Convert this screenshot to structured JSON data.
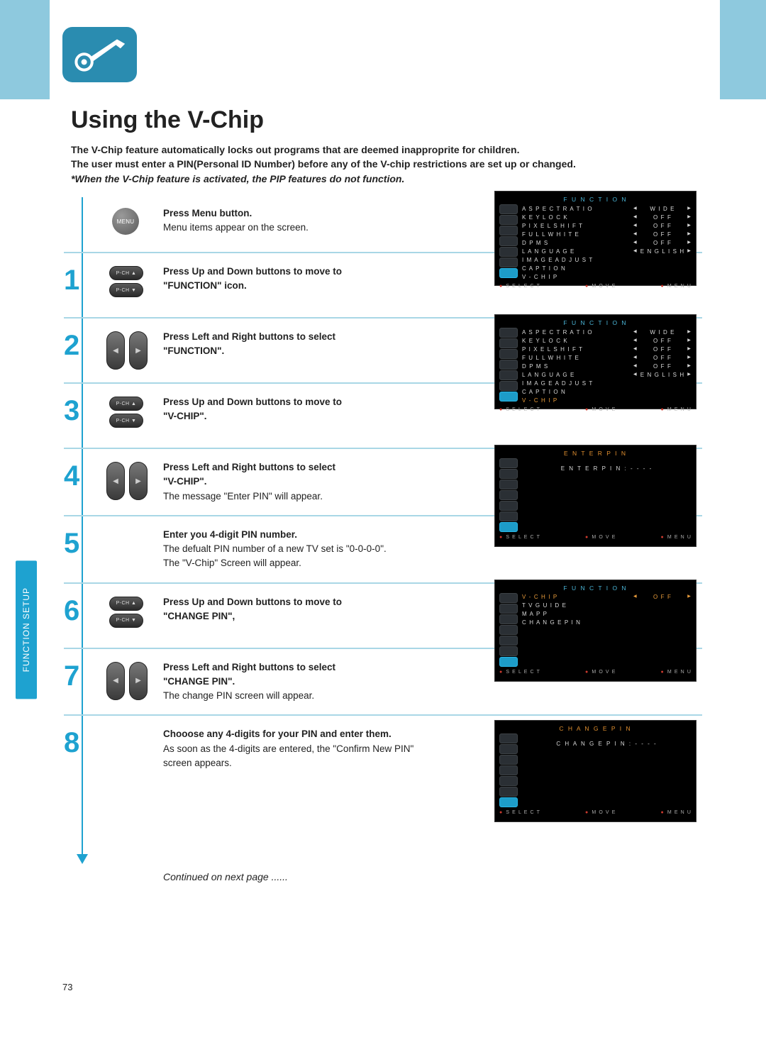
{
  "page_number": "73",
  "side_tab": "FUNCTION SETUP",
  "title": "Using the V-Chip",
  "intro": {
    "line1": "The V-Chip feature automatically locks out programs that are deemed inapproprite for children.",
    "line2": "The user must enter a PIN(Personal ID Number) before any of the V-chip restrictions are set up or changed.",
    "note": "*When the V-Chip feature is activated, the PIP features do not function."
  },
  "continued": "Continued on next page ......",
  "menu_label": "MENU",
  "pch_up": "P-CH ▲",
  "pch_down": "P-CH ▼",
  "arrow_left": "◀",
  "arrow_right": "▶",
  "steps": [
    {
      "num": "",
      "bold": "Press Menu button.",
      "plain": "Menu items appear on the screen."
    },
    {
      "num": "1",
      "bold1": "Press Up and Down buttons to move to",
      "bold2": "\"FUNCTION\" icon."
    },
    {
      "num": "2",
      "bold1": "Press Left and Right buttons to select",
      "bold2": "\"FUNCTION\"."
    },
    {
      "num": "3",
      "bold1": "Press Up and Down buttons to move to",
      "bold2": "\"V-CHIP\"."
    },
    {
      "num": "4",
      "bold1": "Press Left and Right buttons to select",
      "bold2": "\"V-CHIP\".",
      "plain": "The message \"Enter PIN\" will appear."
    },
    {
      "num": "5",
      "bold": "Enter you 4-digit PIN number.",
      "plain1": "The defualt PIN number of a new TV set is \"0-0-0-0\".",
      "plain2": "The \"V-Chip\" Screen will appear."
    },
    {
      "num": "6",
      "bold1": "Press Up and Down buttons to move  to",
      "bold2": "\"CHANGE PIN\","
    },
    {
      "num": "7",
      "bold1": "Press Left and Right buttons to select",
      "bold2": "\"CHANGE PIN\".",
      "plain": "The change PIN screen will appear."
    },
    {
      "num": "8",
      "bold": "Chooose any 4-digits for your PIN and enter them.",
      "plain": "As soon as the 4-digits are entered, the \"Confirm New PIN\" screen appears."
    }
  ],
  "osd": {
    "function_title": "F U N C T I O N",
    "enter_pin_title": "E N T E R   P I N",
    "change_pin_title": "C H A N G E   P I N",
    "enter_pin_line": "E N T E R   P I N   :   -   -   -   -",
    "change_pin_line": "C H A N G E   P I N   :   -   -   -   -",
    "foot_select": "S E L E C T",
    "foot_move": "M O V E",
    "foot_menu": "M E N U",
    "rows_a": [
      {
        "label": "A S P E C T   R A T I O",
        "val": "W I D E"
      },
      {
        "label": "K E Y   L O C K",
        "val": "O F F"
      },
      {
        "label": "P I X E L   S H I F T",
        "val": "O F F"
      },
      {
        "label": "F U L L   W H I T E",
        "val": "O F F"
      },
      {
        "label": "D P M S",
        "val": "O F F"
      },
      {
        "label": "L A N G U A G E",
        "val": "E N G L I S H"
      },
      {
        "label": "I M A G E   A D J U S T",
        "val": ""
      },
      {
        "label": "C A P T I O N",
        "val": ""
      },
      {
        "label": "V - C H I P",
        "val": ""
      }
    ],
    "rows_b": [
      {
        "label": "V - C H I P",
        "val": "O F F",
        "sel": true
      },
      {
        "label": "T V   G U I D E",
        "val": ""
      },
      {
        "label": "M A P P",
        "val": ""
      },
      {
        "label": "C H A N G E   P I N",
        "val": ""
      }
    ]
  }
}
